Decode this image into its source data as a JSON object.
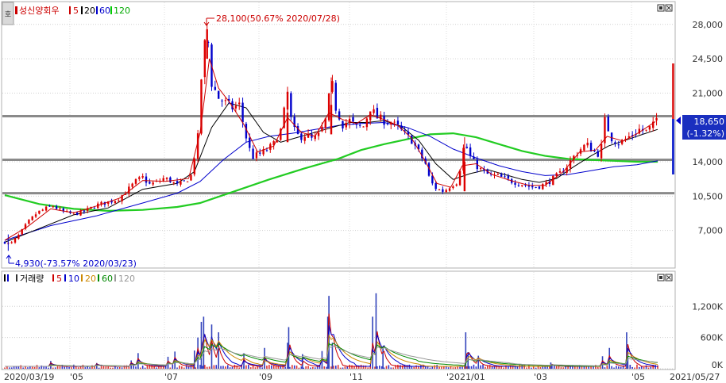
{
  "price_panel": {
    "legend": [
      {
        "label": "성신양회우",
        "color": "#cc0000"
      },
      {
        "label": "5",
        "color": "#cc0000"
      },
      {
        "label": "20",
        "color": "#000000"
      },
      {
        "label": "60",
        "color": "#0000cc"
      },
      {
        "label": "120",
        "color": "#00cc00"
      }
    ],
    "y_ticks": [
      "28,000",
      "24,500",
      "21,000",
      "14,000",
      "10,500",
      "7,000"
    ],
    "high_annotation": "28,100(50.67% 2020/07/28)",
    "low_annotation": "4,930(-73.57% 2020/03/23)",
    "current_price": "18,650",
    "current_change": "(-1.32%)",
    "side_button": "호"
  },
  "volume_panel": {
    "legend": [
      {
        "label": "거래량",
        "color": "#000000"
      },
      {
        "label": "5",
        "color": "#cc0000"
      },
      {
        "label": "10",
        "color": "#0000cc"
      },
      {
        "label": "20",
        "color": "#cc8800"
      },
      {
        "label": "60",
        "color": "#008800"
      },
      {
        "label": "120",
        "color": "#999999"
      }
    ],
    "y_ticks": [
      "1,200K",
      "600K",
      "0K"
    ]
  },
  "x_axis": {
    "labels": [
      "2020/03/19",
      "05",
      "07",
      "09",
      "11",
      "2021/01",
      "03",
      "05",
      "2021/05/27"
    ]
  },
  "chart_data": {
    "type": "candlestick",
    "title": "성신양회우",
    "x_range": [
      "2020/03/19",
      "2021/05/27"
    ],
    "price_ylim": [
      3500,
      30000
    ],
    "volume_ylim": [
      0,
      1600000
    ],
    "moving_averages": [
      "5",
      "20",
      "60",
      "120"
    ],
    "horizontal_lines": [
      18650,
      14200,
      10800
    ],
    "high": {
      "value": 28100,
      "pct": "50.67%",
      "date": "2020/07/28"
    },
    "low": {
      "value": 4930,
      "pct": "-73.57%",
      "date": "2020/03/23"
    },
    "current": {
      "value": 18650,
      "change": "-1.32%"
    },
    "price_path": [
      [
        0,
        5800
      ],
      [
        5,
        5600
      ],
      [
        12,
        6500
      ],
      [
        20,
        7800
      ],
      [
        28,
        8800
      ],
      [
        35,
        9200
      ],
      [
        42,
        9500
      ],
      [
        50,
        8900
      ],
      [
        58,
        8700
      ],
      [
        66,
        8800
      ],
      [
        72,
        9100
      ],
      [
        80,
        9600
      ],
      [
        90,
        9900
      ],
      [
        98,
        10200
      ],
      [
        106,
        11000
      ],
      [
        114,
        12000
      ],
      [
        120,
        12400
      ],
      [
        126,
        11700
      ],
      [
        132,
        11900
      ],
      [
        138,
        12300
      ],
      [
        144,
        12100
      ],
      [
        150,
        11600
      ],
      [
        156,
        11900
      ],
      [
        162,
        12600
      ],
      [
        168,
        16500
      ],
      [
        172,
        24500
      ],
      [
        176,
        27500
      ],
      [
        180,
        22000
      ],
      [
        186,
        20500
      ],
      [
        192,
        20000
      ],
      [
        198,
        19500
      ],
      [
        204,
        19800
      ],
      [
        208,
        17500
      ],
      [
        212,
        15500
      ],
      [
        216,
        14500
      ],
      [
        222,
        14800
      ],
      [
        228,
        15200
      ],
      [
        234,
        15800
      ],
      [
        240,
        17200
      ],
      [
        246,
        21000
      ],
      [
        250,
        17500
      ],
      [
        256,
        16500
      ],
      [
        262,
        16800
      ],
      [
        268,
        16200
      ],
      [
        274,
        16800
      ],
      [
        280,
        18500
      ],
      [
        284,
        22500
      ],
      [
        288,
        19500
      ],
      [
        294,
        17800
      ],
      [
        300,
        18200
      ],
      [
        306,
        17500
      ],
      [
        312,
        17600
      ],
      [
        318,
        19500
      ],
      [
        324,
        18500
      ],
      [
        330,
        18200
      ],
      [
        336,
        18000
      ],
      [
        342,
        17500
      ],
      [
        348,
        16800
      ],
      [
        354,
        16200
      ],
      [
        360,
        15000
      ],
      [
        366,
        13800
      ],
      [
        370,
        12000
      ],
      [
        376,
        11200
      ],
      [
        382,
        11000
      ],
      [
        388,
        11600
      ],
      [
        394,
        12000
      ],
      [
        400,
        16000
      ],
      [
        406,
        14200
      ],
      [
        412,
        13400
      ],
      [
        418,
        12800
      ],
      [
        424,
        12600
      ],
      [
        430,
        12500
      ],
      [
        436,
        12200
      ],
      [
        442,
        12000
      ],
      [
        448,
        11800
      ],
      [
        454,
        11600
      ],
      [
        458,
        11400
      ],
      [
        464,
        11500
      ],
      [
        470,
        11700
      ],
      [
        476,
        12200
      ],
      [
        482,
        12700
      ],
      [
        488,
        13400
      ],
      [
        494,
        14400
      ],
      [
        500,
        15200
      ],
      [
        506,
        15800
      ],
      [
        512,
        15100
      ],
      [
        518,
        14700
      ],
      [
        522,
        18200
      ],
      [
        528,
        16400
      ],
      [
        534,
        15900
      ],
      [
        540,
        16300
      ],
      [
        546,
        16800
      ],
      [
        552,
        17300
      ],
      [
        558,
        17100
      ],
      [
        564,
        17700
      ],
      [
        568,
        18650
      ]
    ],
    "ma5": [
      [
        0,
        6000
      ],
      [
        20,
        7400
      ],
      [
        40,
        9200
      ],
      [
        60,
        8800
      ],
      [
        80,
        9500
      ],
      [
        100,
        10300
      ],
      [
        120,
        12100
      ],
      [
        140,
        12000
      ],
      [
        160,
        12300
      ],
      [
        170,
        17000
      ],
      [
        178,
        24500
      ],
      [
        186,
        21500
      ],
      [
        196,
        20000
      ],
      [
        208,
        17800
      ],
      [
        220,
        15000
      ],
      [
        234,
        15600
      ],
      [
        246,
        18500
      ],
      [
        258,
        17000
      ],
      [
        270,
        16600
      ],
      [
        282,
        19000
      ],
      [
        294,
        18300
      ],
      [
        306,
        17900
      ],
      [
        318,
        18800
      ],
      [
        330,
        18300
      ],
      [
        342,
        17700
      ],
      [
        354,
        16400
      ],
      [
        366,
        14000
      ],
      [
        376,
        11800
      ],
      [
        388,
        11400
      ],
      [
        398,
        13600
      ],
      [
        410,
        13800
      ],
      [
        424,
        12700
      ],
      [
        440,
        12100
      ],
      [
        456,
        11600
      ],
      [
        470,
        11600
      ],
      [
        486,
        13000
      ],
      [
        500,
        15000
      ],
      [
        514,
        15200
      ],
      [
        524,
        16600
      ],
      [
        538,
        16100
      ],
      [
        552,
        17000
      ],
      [
        566,
        18100
      ]
    ],
    "ma20": [
      [
        0,
        5800
      ],
      [
        30,
        7200
      ],
      [
        60,
        8600
      ],
      [
        90,
        9300
      ],
      [
        120,
        11200
      ],
      [
        150,
        11800
      ],
      [
        165,
        13000
      ],
      [
        180,
        17500
      ],
      [
        195,
        20000
      ],
      [
        210,
        19500
      ],
      [
        225,
        17000
      ],
      [
        240,
        16000
      ],
      [
        255,
        16500
      ],
      [
        270,
        17000
      ],
      [
        285,
        17500
      ],
      [
        300,
        18000
      ],
      [
        315,
        18000
      ],
      [
        330,
        18200
      ],
      [
        345,
        17600
      ],
      [
        360,
        16200
      ],
      [
        375,
        13800
      ],
      [
        390,
        12200
      ],
      [
        405,
        12800
      ],
      [
        420,
        13200
      ],
      [
        435,
        12700
      ],
      [
        450,
        12200
      ],
      [
        465,
        11900
      ],
      [
        480,
        12300
      ],
      [
        495,
        13500
      ],
      [
        510,
        14600
      ],
      [
        525,
        15600
      ],
      [
        540,
        16200
      ],
      [
        555,
        16800
      ],
      [
        568,
        17300
      ]
    ],
    "ma60": [
      [
        0,
        6000
      ],
      [
        40,
        7500
      ],
      [
        80,
        8500
      ],
      [
        120,
        9800
      ],
      [
        150,
        10800
      ],
      [
        170,
        12000
      ],
      [
        190,
        14200
      ],
      [
        210,
        16000
      ],
      [
        230,
        16600
      ],
      [
        250,
        16900
      ],
      [
        270,
        17300
      ],
      [
        290,
        17700
      ],
      [
        310,
        17900
      ],
      [
        330,
        18000
      ],
      [
        350,
        17500
      ],
      [
        370,
        16600
      ],
      [
        390,
        15300
      ],
      [
        410,
        14400
      ],
      [
        430,
        13600
      ],
      [
        450,
        13000
      ],
      [
        470,
        12600
      ],
      [
        490,
        12700
      ],
      [
        510,
        13100
      ],
      [
        530,
        13500
      ],
      [
        550,
        13700
      ],
      [
        568,
        14100
      ]
    ],
    "ma120": [
      [
        0,
        10600
      ],
      [
        30,
        9700
      ],
      [
        60,
        9200
      ],
      [
        90,
        9000
      ],
      [
        120,
        9100
      ],
      [
        150,
        9400
      ],
      [
        170,
        9800
      ],
      [
        200,
        11000
      ],
      [
        230,
        12200
      ],
      [
        260,
        13300
      ],
      [
        290,
        14300
      ],
      [
        310,
        15200
      ],
      [
        330,
        15800
      ],
      [
        350,
        16300
      ],
      [
        370,
        16800
      ],
      [
        390,
        16900
      ],
      [
        410,
        16500
      ],
      [
        430,
        15800
      ],
      [
        450,
        15100
      ],
      [
        470,
        14600
      ],
      [
        490,
        14300
      ],
      [
        510,
        14200
      ],
      [
        530,
        14100
      ],
      [
        550,
        14000
      ],
      [
        568,
        14000
      ]
    ],
    "volume_spikes": [
      [
        40,
        150000
      ],
      [
        80,
        110000
      ],
      [
        110,
        160000
      ],
      [
        116,
        300000
      ],
      [
        142,
        230000
      ],
      [
        148,
        330000
      ],
      [
        165,
        350000
      ],
      [
        168,
        600000
      ],
      [
        171,
        900000
      ],
      [
        173,
        1000000
      ],
      [
        180,
        850000
      ],
      [
        186,
        700000
      ],
      [
        208,
        300000
      ],
      [
        226,
        400000
      ],
      [
        246,
        500000
      ],
      [
        247,
        800000
      ],
      [
        259,
        280000
      ],
      [
        276,
        340000
      ],
      [
        281,
        1000000
      ],
      [
        282,
        1400000
      ],
      [
        285,
        500000
      ],
      [
        320,
        1000000
      ],
      [
        323,
        1450000
      ],
      [
        329,
        400000
      ],
      [
        401,
        700000
      ],
      [
        403,
        320000
      ],
      [
        412,
        250000
      ],
      [
        475,
        120000
      ],
      [
        520,
        240000
      ],
      [
        526,
        400000
      ],
      [
        541,
        700000
      ],
      [
        542,
        400000
      ]
    ]
  }
}
